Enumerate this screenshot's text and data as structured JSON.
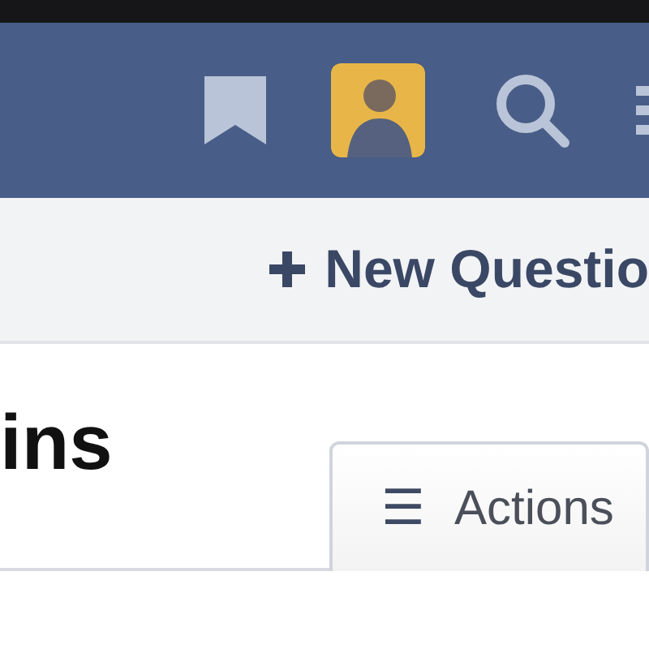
{
  "header": {
    "icons": [
      {
        "kind": "bookmark"
      },
      {
        "kind": "avatar"
      },
      {
        "kind": "search"
      },
      {
        "kind": "menu"
      }
    ]
  },
  "toolbar": {
    "new_question": "New Questio"
  },
  "page": {
    "title_fragment": "ins",
    "actions_button": {
      "icon": "☰",
      "label": "Actions"
    }
  }
}
